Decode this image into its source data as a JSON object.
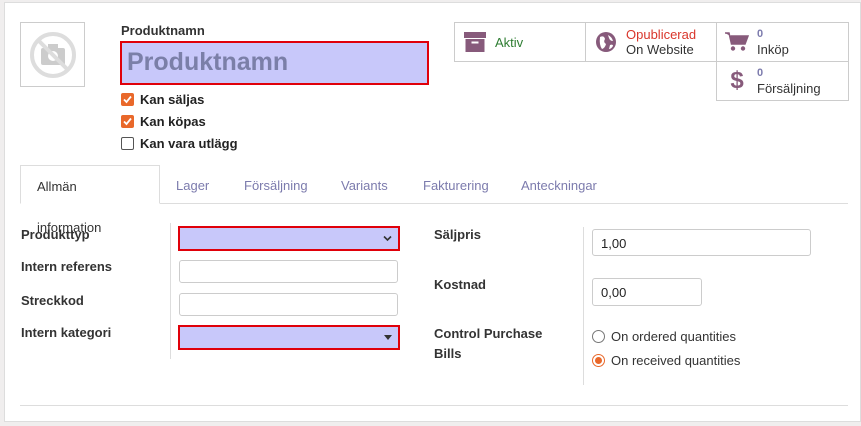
{
  "product": {
    "name_label": "Produktnamn",
    "name_placeholder": "Produktnamn",
    "checkboxes": [
      {
        "label": "Kan säljas",
        "checked": true
      },
      {
        "label": "Kan köpas",
        "checked": true
      },
      {
        "label": "Kan vara utlägg",
        "checked": false
      }
    ]
  },
  "stats": {
    "active": "Aktiv",
    "website_state": "Opublicerad",
    "website_label": "On Website",
    "purchases_count": "0",
    "purchases_label": "Inköp",
    "sales_count": "0",
    "sales_label": "Försäljning"
  },
  "tabs": [
    "Allmän information",
    "Lager",
    "Försäljning",
    "Variants",
    "Fakturering",
    "Anteckningar"
  ],
  "form": {
    "product_type_label": "Produkttyp",
    "internal_ref_label": "Intern referens",
    "barcode_label": "Streckkod",
    "internal_category_label": "Intern kategori",
    "sale_price_label": "Säljpris",
    "sale_price_value": "1,00",
    "cost_label": "Kostnad",
    "cost_value": "0,00",
    "control_label_1": "Control Purchase",
    "control_label_2": "Bills",
    "control_options": [
      {
        "label": "On ordered quantities",
        "selected": false
      },
      {
        "label": "On received quantities",
        "selected": true
      }
    ]
  },
  "colors": {
    "accent": "#e9682a",
    "link": "#7c7bad",
    "highlight": "#c8c8fa",
    "focus_border": "#e0000a",
    "brand": "#875a7b"
  }
}
